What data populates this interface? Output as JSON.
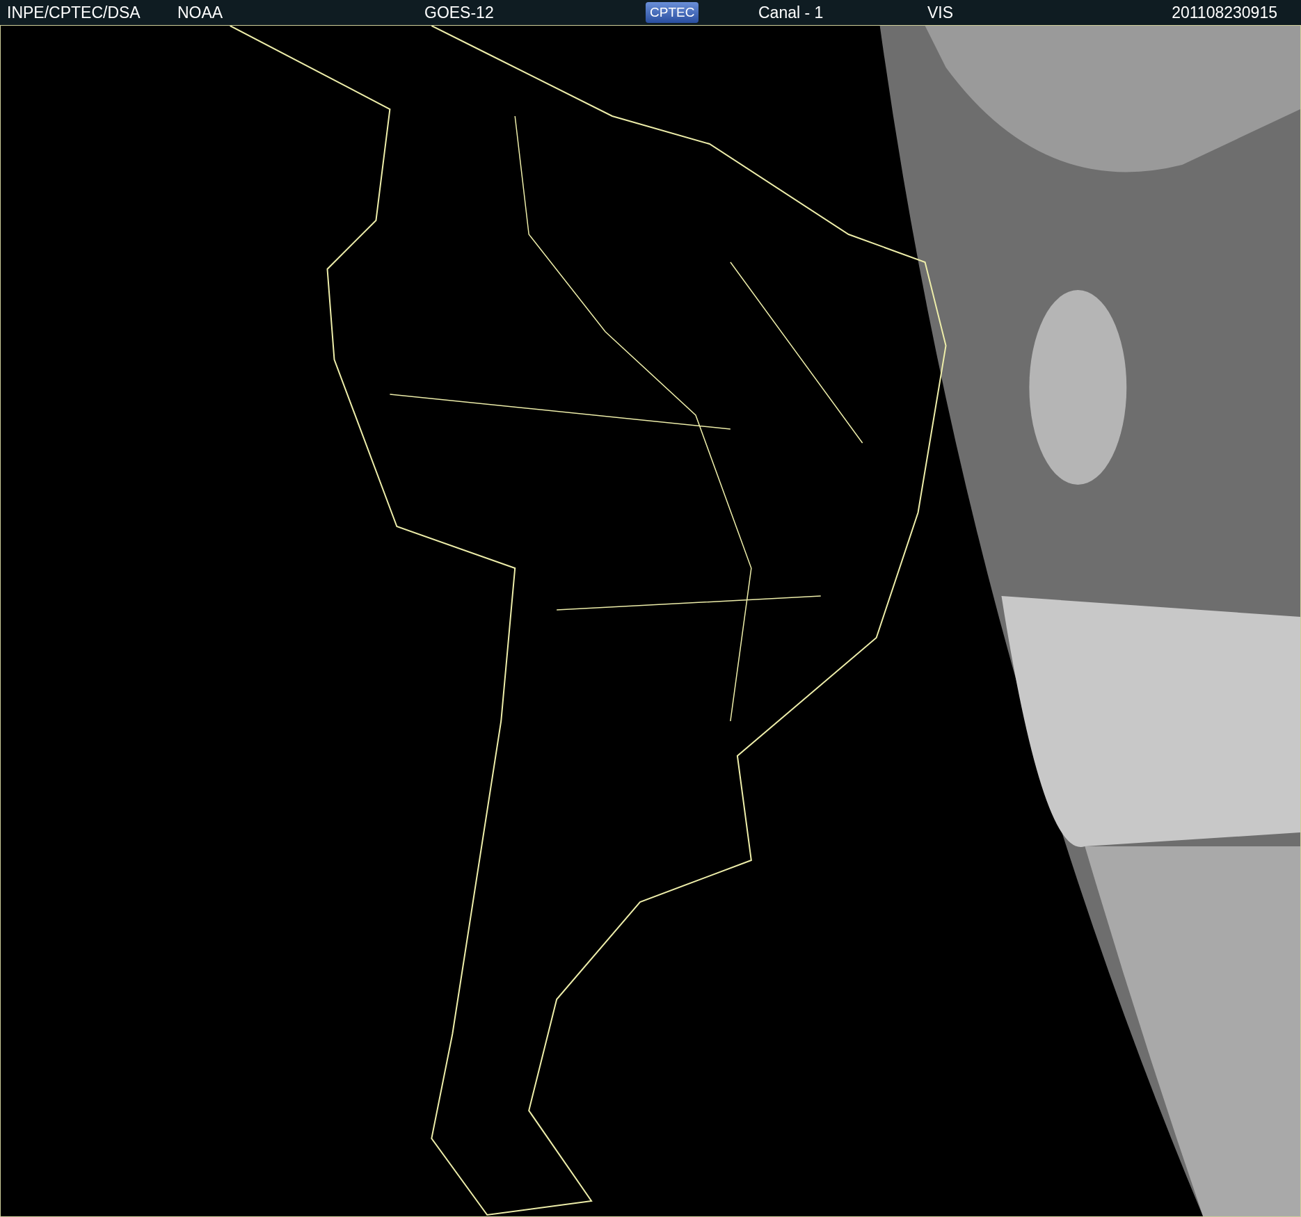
{
  "header": {
    "source": "INPE/CPTEC/DSA",
    "agency": "NOAA",
    "satellite": "GOES-12",
    "logo": "CPTEC",
    "channel": "Canal - 1",
    "band": "VIS",
    "timestamp": "201108230915"
  }
}
